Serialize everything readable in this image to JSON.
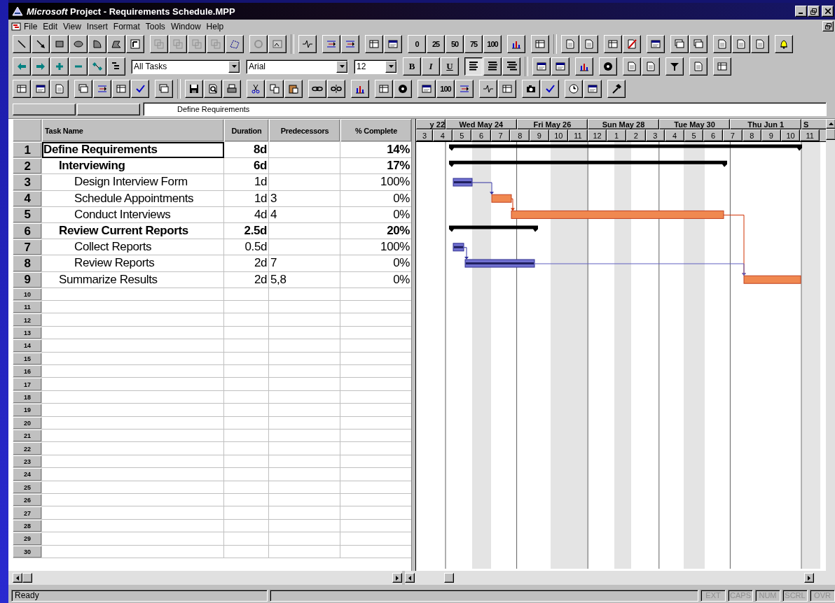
{
  "window": {
    "title": "*Microsoft* Project - Requirements Schedule.MPP"
  },
  "menu": [
    "File",
    "Edit",
    "View",
    "Insert",
    "Format",
    "Tools",
    "Window",
    "Help"
  ],
  "toolbars": {
    "percent_buttons": [
      "0",
      "25",
      "50",
      "75",
      "100"
    ],
    "view_filter": "All Tasks",
    "font": "Arial",
    "font_size": "12",
    "format_buttons": [
      "B",
      "I",
      "U"
    ],
    "align_buttons": [
      {
        "selected": true
      },
      {
        "selected": false
      },
      {
        "selected": false
      }
    ],
    "tracking_button": "100"
  },
  "entry_bar": {
    "value": "Define Requirements"
  },
  "table": {
    "columns": [
      "Task Name",
      "Duration",
      "Predecessors",
      "% Complete"
    ],
    "tasks": [
      {
        "id": "1",
        "name": "Define Requirements",
        "duration": "8d",
        "complete": "14%",
        "selected": true,
        "children": [
          {
            "id": "2",
            "name": "Interviewing",
            "duration": "6d",
            "complete": "17%",
            "selected": false,
            "children": [
              {
                "id": "3",
                "name": "Design Interview Form",
                "duration": "1d",
                "complete": "100%",
                "selected": false
              },
              {
                "id": "4",
                "name": "Schedule Appointments",
                "duration": "1d",
                "predecessors": "3",
                "complete": "0%",
                "selected": false
              },
              {
                "id": "5",
                "name": "Conduct Interviews",
                "duration": "4d",
                "predecessors": "4",
                "complete": "0%",
                "selected": false
              }
            ]
          },
          {
            "id": "6",
            "name": "Review Current Reports",
            "duration": "2.5d",
            "complete": "20%",
            "selected": false,
            "children": [
              {
                "id": "7",
                "name": "Collect Reports",
                "duration": "0.5d",
                "complete": "100%",
                "selected": false
              },
              {
                "id": "8",
                "name": "Review Reports",
                "duration": "2d",
                "predecessors": "7",
                "complete": "0%",
                "selected": false
              }
            ]
          },
          {
            "id": "9",
            "name": "Summarize Results",
            "duration": "2d",
            "predecessors": "5,8",
            "complete": "0%",
            "selected": false
          }
        ]
      }
    ],
    "empty_rows": [
      "10",
      "11",
      "12",
      "13",
      "14",
      "15",
      "16",
      "17",
      "18",
      "19",
      "20",
      "21",
      "22",
      "23",
      "24",
      "25",
      "26",
      "27",
      "28",
      "29",
      "30"
    ]
  },
  "timescale": {
    "major": [
      "y 22",
      "Wed May 24",
      "Fri May 26",
      "Sun May 28",
      "Tue May 30",
      "Thu Jun 1",
      "S"
    ],
    "minor": [
      "3",
      "4",
      "5",
      "6",
      "7",
      "8",
      "9",
      "10",
      "11",
      "12",
      "1",
      "2",
      "3",
      "4",
      "5",
      "6",
      "7",
      "8",
      "9",
      "10",
      "11"
    ]
  },
  "status_bar": {
    "message": "Ready",
    "indicators": [
      {
        "label": "EXT",
        "on": false
      },
      {
        "label": "CAPS",
        "on": false
      },
      {
        "label": "NUM",
        "on": false
      },
      {
        "label": "SCRL",
        "on": false
      },
      {
        "label": "OVR",
        "on": false
      }
    ]
  }
}
